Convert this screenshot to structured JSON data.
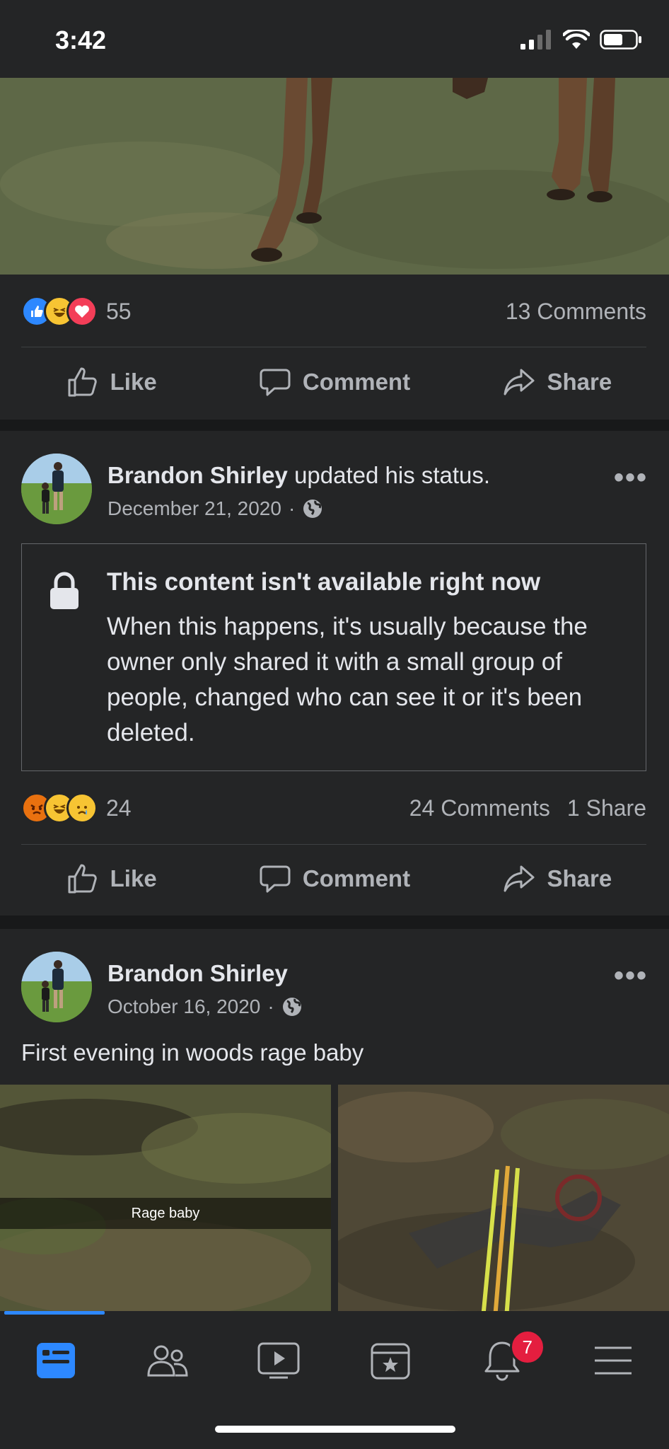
{
  "status_bar": {
    "time": "3:42"
  },
  "post1": {
    "reaction_count": "55",
    "comments": "13 Comments",
    "actions": {
      "like": "Like",
      "comment": "Comment",
      "share": "Share"
    }
  },
  "post2": {
    "author": "Brandon Shirley",
    "activity": "updated his status.",
    "date": "December 21, 2020",
    "more": "•••",
    "unavailable": {
      "title": "This content isn't available right now",
      "body": "When this happens, it's usually because the owner only shared it with a small group of people, changed who can see it or it's been deleted."
    },
    "reaction_count": "24",
    "comments": "24 Comments",
    "shares": "1 Share",
    "actions": {
      "like": "Like",
      "comment": "Comment",
      "share": "Share"
    }
  },
  "post3": {
    "author": "Brandon Shirley",
    "date": "October 16, 2020",
    "more": "•••",
    "text": "First evening in woods rage baby",
    "photo_caption": "Rage baby"
  },
  "bottom_nav": {
    "items": [
      "home-icon",
      "friends-icon",
      "watch-icon",
      "marketplace-icon",
      "notifications-icon",
      "menu-icon"
    ],
    "notification_badge": "7",
    "accent_color": "#2d88ff"
  }
}
